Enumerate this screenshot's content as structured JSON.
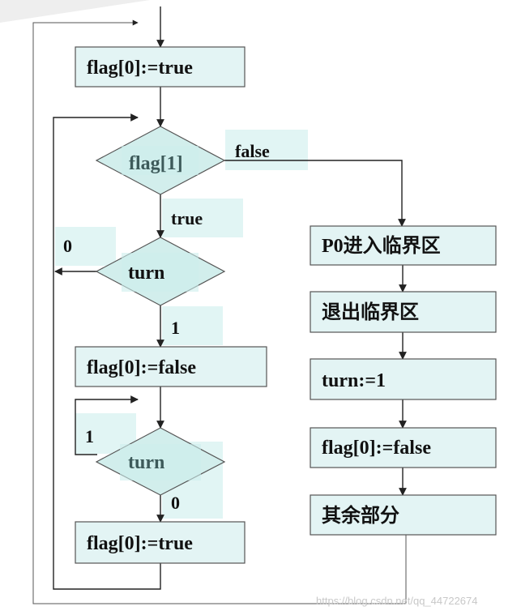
{
  "nodes": {
    "set_flag0_true_top": "flag[0]:=true",
    "check_flag1": "flag[1]",
    "check_turn": "turn",
    "set_flag0_false": "flag[0]:=false",
    "wait_turn": "turn",
    "set_flag0_true_bottom": "flag[0]:=true",
    "p0_enter_critical": "P0进入临界区",
    "exit_critical": "退出临界区",
    "set_turn": "turn:=1",
    "set_flag0_false_right": "flag[0]:=false",
    "remainder": "其余部分"
  },
  "edge_labels": {
    "flag1_false": "false",
    "flag1_true": "true",
    "turn_zero": "0",
    "turn_one": "1",
    "wait_one": "1",
    "wait_zero": "0"
  },
  "watermark": "https://blog.csdn.net/qq_44722674"
}
